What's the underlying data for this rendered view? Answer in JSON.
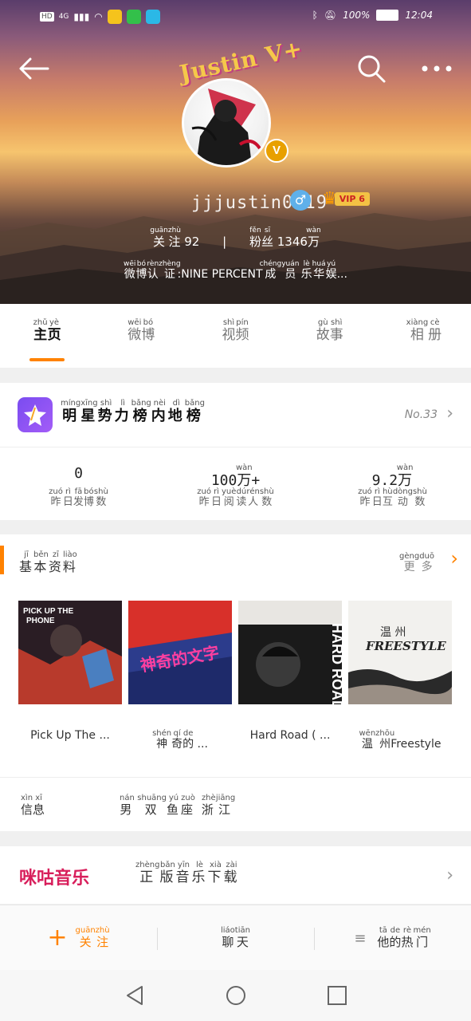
{
  "status_bar": {
    "left_text": "HD",
    "network": "4G",
    "battery": "100%",
    "time": "12:04"
  },
  "header": {
    "back_icon": "back-arrow-icon",
    "search_icon": "search-icon",
    "more_icon": "more-dots-icon",
    "brand_text": "Justin V+",
    "vbadge": "V",
    "username": "jjjustin0219",
    "gender_symbol": "♂",
    "vip_label": "VIP 6",
    "following_label": "关注",
    "following_count": "92",
    "followers_label": "粉丝",
    "followers_count": "1346万",
    "verified_text": "微博认证:NINE PERCENT成员 乐华娱..."
  },
  "tabs": [
    {
      "label": "主页",
      "active": true
    },
    {
      "label": "微博",
      "active": false
    },
    {
      "label": "视频",
      "active": false
    },
    {
      "label": "故事",
      "active": false
    },
    {
      "label": "相册",
      "active": false
    }
  ],
  "ranking": {
    "title": "明星势力榜内地榜",
    "rank": "No.33"
  },
  "counts": [
    {
      "value": "0",
      "label": "昨日发博数"
    },
    {
      "value": "100万+",
      "label": "昨日阅读人数"
    },
    {
      "value": "9.2万",
      "label": "昨日互动数"
    }
  ],
  "profile_section": {
    "title": "基本资料",
    "more": "更多"
  },
  "albums": [
    {
      "title": "Pick Up The ...",
      "cover_text": "PICK UP THE PHONE"
    },
    {
      "title": "神奇的 ...",
      "cover_text": "神奇的文字"
    },
    {
      "title": "Hard Road ( ...",
      "cover_text": "HARD ROAD"
    },
    {
      "title": "温州Freestyle",
      "cover_text": "温 州 FREESTYLE"
    }
  ],
  "info": {
    "key": "信息",
    "value": "男 双鱼座 浙江"
  },
  "music": {
    "logo": "咪咕音乐",
    "title": "正版音乐下载"
  },
  "actions": {
    "follow": "关注",
    "chat": "聊天",
    "hot": "他的热门"
  },
  "colors": {
    "accent": "#ff8200",
    "rank_icon": "#8a52f2",
    "migu": "#d81e5b"
  }
}
